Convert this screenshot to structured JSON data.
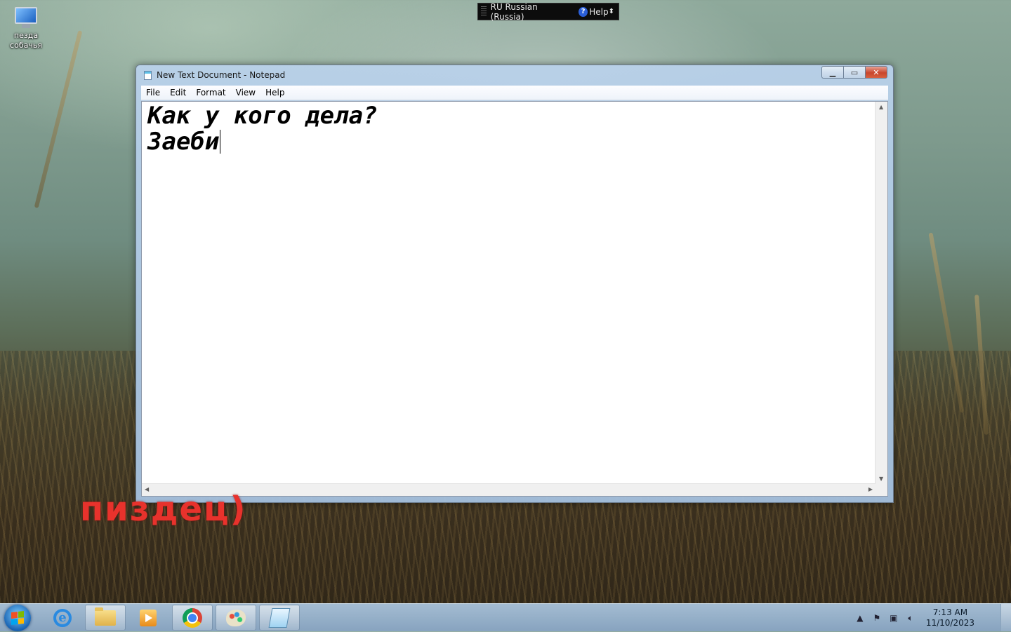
{
  "desktop": {
    "icon_label": "пезда собачья",
    "overlay_text": "пиздец)"
  },
  "language_bar": {
    "language": "RU Russian (Russia)",
    "help": "Help"
  },
  "notepad": {
    "title": "New Text Document - Notepad",
    "menu": [
      "File",
      "Edit",
      "Format",
      "View",
      "Help"
    ],
    "content_line1": "Как у кого дела?",
    "content_line2": "Заеби"
  },
  "taskbar": {
    "clock_time": "7:13 AM",
    "clock_date": "11/10/2023",
    "icons": [
      "start-orb",
      "internet-explorer",
      "windows-explorer",
      "media-player",
      "chrome",
      "paint",
      "notepad"
    ]
  },
  "colors": {
    "overlay_red": "#e8322c",
    "close_button_red": "#c9462c",
    "window_frame": "#b9d1ea"
  }
}
